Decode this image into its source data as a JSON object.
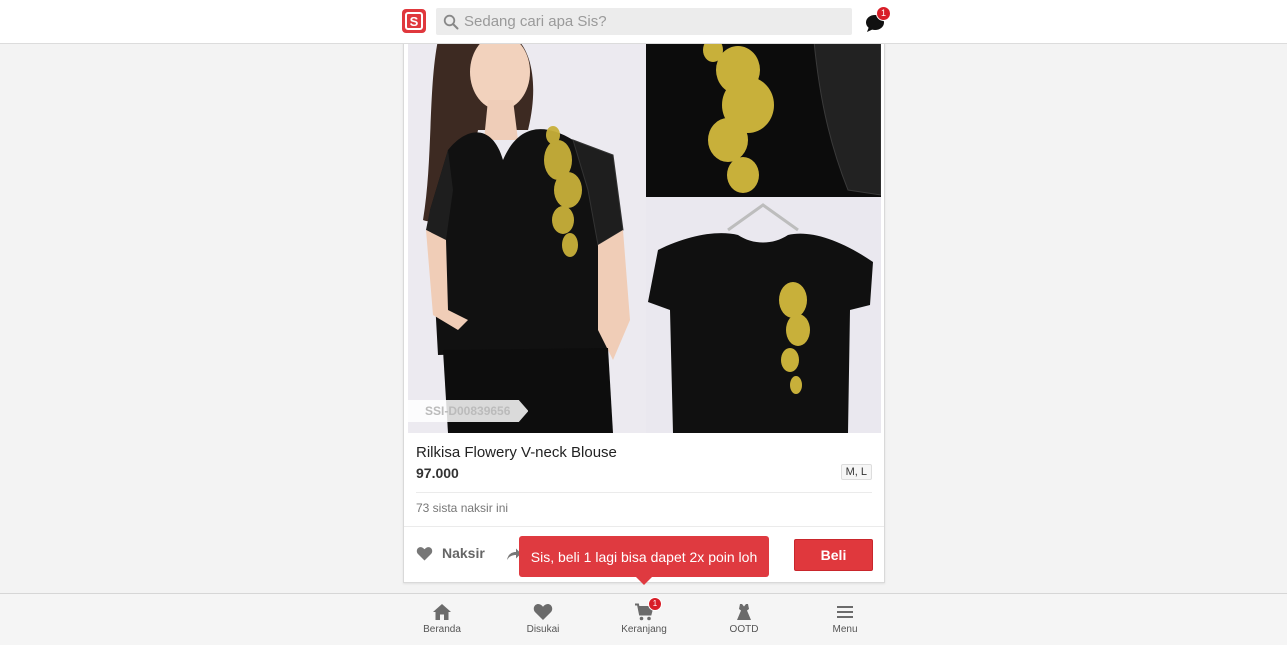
{
  "header": {
    "logo_text": "S",
    "search_placeholder": "Sedang cari apa Sis?",
    "chat_badge": "1"
  },
  "product": {
    "code": "SSI-D00839656",
    "name": "Rilkisa Flowery V-neck Blouse",
    "price": "97.000",
    "sizes": "M, L",
    "likes_text": "73 sista naksir ini",
    "like_label": "Naksir",
    "buy_label": "Beli"
  },
  "tooltip": {
    "text": "Sis, beli 1 lagi bisa dapet 2x poin loh"
  },
  "bottom_nav": {
    "items": [
      {
        "label": "Beranda",
        "icon": "home-icon"
      },
      {
        "label": "Disukai",
        "icon": "heart-icon"
      },
      {
        "label": "Keranjang",
        "icon": "cart-icon",
        "badge": "1"
      },
      {
        "label": "OOTD",
        "icon": "dress-icon"
      },
      {
        "label": "Menu",
        "icon": "menu-icon"
      }
    ]
  },
  "colors": {
    "brand": "#e0383d",
    "badge": "#d81e28",
    "embroidery": "#c8b03a"
  }
}
